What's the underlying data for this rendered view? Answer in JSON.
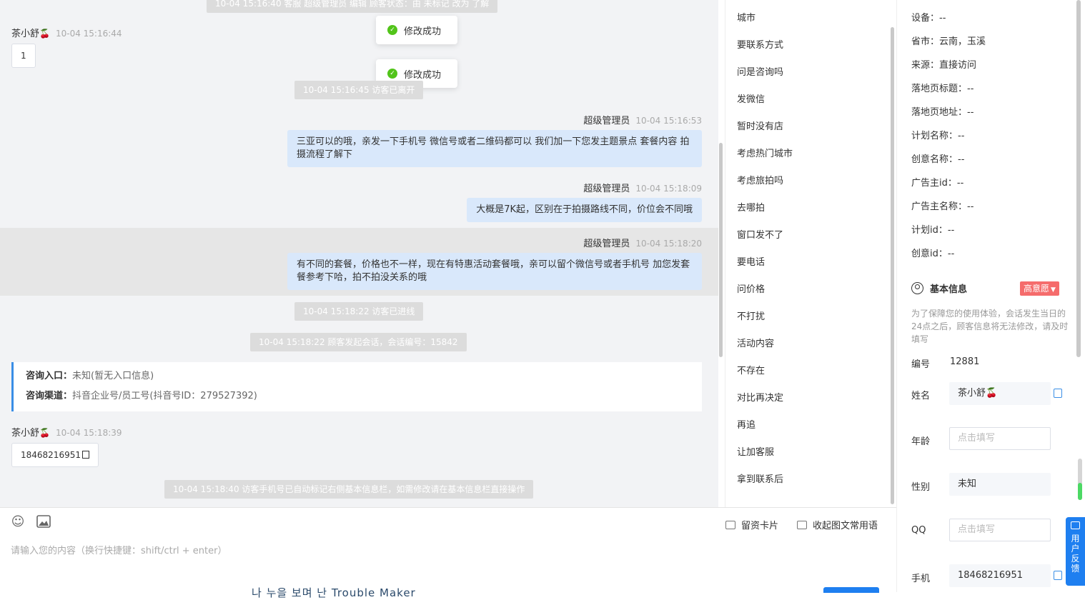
{
  "chat": {
    "sys_top": "10-04 15:16:40 客服 超级管理员 编辑 顾客状态：由 未标记 改为 了解",
    "visitor1": {
      "name": "茶小舒",
      "emoji": "🍒",
      "time": "10-04 15:16:44",
      "text": "1"
    },
    "toasts": [
      "修改成功",
      "修改成功"
    ],
    "sys_left": "10-04 15:16:45 访客已离开",
    "agent_messages": [
      {
        "name": "超级管理员",
        "time": "10-04 15:16:53",
        "text": "三亚可以的哦，亲发一下手机号 微信号或者二维码都可以 我们加一下您发主题景点 套餐内容 拍摄流程了解下"
      },
      {
        "name": "超级管理员",
        "time": "10-04 15:18:09",
        "text": "大概是7K起，区别在于拍摄路线不同，价位会不同哦"
      },
      {
        "name": "超级管理员",
        "time": "10-04 15:18:20",
        "text": "有不同的套餐，价格也不一样，现在有特惠活动套餐哦，亲可以留个微信号或者手机号 加您发套餐参考下哈，拍不拍没关系的哦"
      }
    ],
    "sys_enter": "10-04 15:18:22 访客已进线",
    "sys_session": "10-04 15:18:22 顾客发起会话，会话编号：15842",
    "entry": {
      "label1": "咨询入口：",
      "value1": "未知(暂无入口信息)",
      "label2": "咨询渠道：",
      "value2": "抖音企业号/员工号(抖音号ID：279527392)"
    },
    "visitor2": {
      "name": "茶小舒",
      "emoji": "🍒",
      "time": "10-04 15:18:39",
      "text": "18468216951"
    },
    "sys_phone": "10-04 15:18:40 访客手机号已自动标记右侧基本信息栏，如需修改请在基本信息栏直接操作"
  },
  "quick_replies": [
    "城市",
    "要联系方式",
    "问是咨询吗",
    "发微信",
    "暂时没有店",
    "考虑热门城市",
    "考虑旅拍吗",
    "去哪拍",
    "窗口发不了",
    "要电话",
    "问价格",
    "不打扰",
    "活动内容",
    "不存在",
    "对比再决定",
    "再追",
    "让加客服",
    "拿到联系后"
  ],
  "input": {
    "emoji_icon": "smile-icon",
    "image_icon": "image-icon",
    "placeholder": "请输入您的内容（换行快捷键：shift/ctrl + enter）",
    "card_btn": "留资卡片",
    "collapse_btn": "收起图文常用语",
    "ime_text": "나 누을 보며 난 Trouble Maker"
  },
  "info": {
    "meta": [
      {
        "label": "设备：",
        "value": "--"
      },
      {
        "label": "省市：",
        "value": "云南，玉溪"
      },
      {
        "label": "来源：",
        "value": "直接访问"
      },
      {
        "label": "落地页标题：",
        "value": "--"
      },
      {
        "label": "落地页地址：",
        "value": "--"
      },
      {
        "label": "计划名称：",
        "value": "--"
      },
      {
        "label": "创意名称：",
        "value": "--"
      },
      {
        "label": "广告主id：",
        "value": "--"
      },
      {
        "label": "广告主名称：",
        "value": "--"
      },
      {
        "label": "计划id：",
        "value": "--"
      },
      {
        "label": "创意id：",
        "value": "--"
      }
    ],
    "section_title": "基本信息",
    "intent_tag": "高意愿",
    "notice": "为了保障您的使用体验，会话发生当日的24点之后，顾客信息将无法修改，请及时填写",
    "id_label": "编号",
    "id_value": "12881",
    "name_label": "姓名",
    "name_value": "茶小舒🍒",
    "age_label": "年龄",
    "age_placeholder": "点击填写",
    "gender_label": "性别",
    "gender_value": "未知",
    "qq_label": "QQ",
    "qq_placeholder": "点击填写",
    "phone_label": "手机",
    "phone_value": "18468216951",
    "feedback": "用户反馈"
  },
  "colors": {
    "accent": "#1e7ff0",
    "agent_bubble": "#d9e8fb",
    "intent": "#f56c6c",
    "success": "#52c41a"
  }
}
